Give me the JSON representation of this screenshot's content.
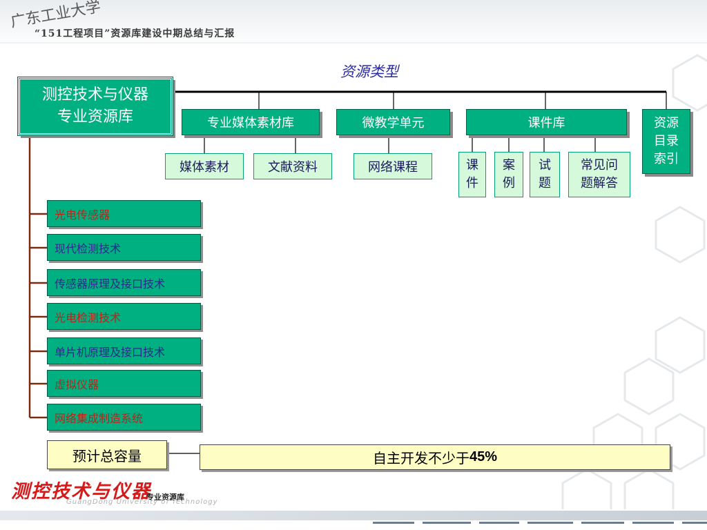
{
  "header": {
    "university": "广东工业大学",
    "subtitle": "“151工程项目”资源库建设中期总结与汇报"
  },
  "diagram": {
    "title": "资源类型",
    "root": {
      "line1": "测控技术与仪器",
      "line2": "专业资源库"
    },
    "categories": {
      "media": "专业媒体素材库",
      "micro": "微教学单元",
      "courseware": "课件库",
      "index": {
        "line1": "资源",
        "line2": "目录",
        "line3": "索引"
      }
    },
    "subcategories": {
      "media_material": "媒体素材",
      "document_material": "文献资料",
      "online_course": "网络课程",
      "courseware": {
        "line1": "课",
        "line2": "件"
      },
      "case": {
        "line1": "案",
        "line2": "例"
      },
      "exam": {
        "line1": "试",
        "line2": "题"
      },
      "faq": {
        "line1": "常见问",
        "line2": "题解答"
      }
    },
    "courses": [
      {
        "label": "光电传感器",
        "color": "#b8241a"
      },
      {
        "label": "现代检测技术",
        "color": "#2a2a8c"
      },
      {
        "label": "传感器原理及接口技术",
        "color": "#2a2a8c"
      },
      {
        "label": "光电检测技术",
        "color": "#b8241a"
      },
      {
        "label": "单片机原理及接口技术",
        "color": "#2a2a8c"
      },
      {
        "label": "虚拟仪器",
        "color": "#b8241a"
      },
      {
        "label": "网络集成制造系统",
        "color": "#b8241a"
      }
    ],
    "capacity_label": "预计总容量",
    "capacity_value_prefix": "自主开发不少于",
    "capacity_value_number": "45%"
  },
  "footer": {
    "logo_text": "测控技术与仪器",
    "logo_sub": "专业资源库",
    "logo_english": "GuangDong University of Technology"
  },
  "colors": {
    "primary_green": "#00b080",
    "light_green": "#d6f9dc",
    "bracket_brown": "#7a2a10",
    "capacity_yellow": "#fdfdc4"
  }
}
